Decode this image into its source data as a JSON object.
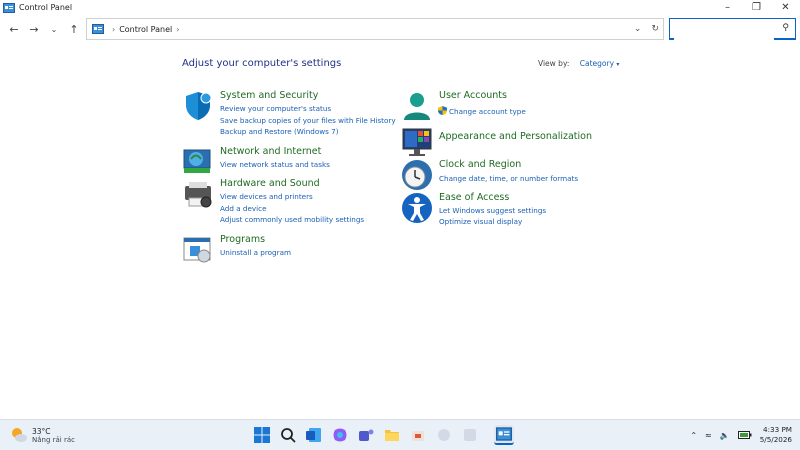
{
  "window": {
    "title": "Control Panel",
    "minimize_icon": "minimize-icon",
    "maximize_icon": "restore-icon",
    "close_icon": "close-icon"
  },
  "address_bar": {
    "breadcrumb": "Control Panel",
    "search_placeholder": ""
  },
  "main": {
    "heading": "Adjust your computer's settings",
    "view_by_label": "View by:",
    "view_by_value": "Category",
    "categories_left": [
      {
        "title": "System and Security",
        "icon": "shield-icon",
        "links": [
          "Review your computer's status",
          "Save backup copies of your files with File History",
          "Backup and Restore (Windows 7)"
        ]
      },
      {
        "title": "Network and Internet",
        "icon": "network-icon",
        "links": [
          "View network status and tasks"
        ]
      },
      {
        "title": "Hardware and Sound",
        "icon": "printer-icon",
        "links": [
          "View devices and printers",
          "Add a device",
          "Adjust commonly used mobility settings"
        ]
      },
      {
        "title": "Programs",
        "icon": "programs-icon",
        "links": [
          "Uninstall a program"
        ]
      }
    ],
    "categories_right": [
      {
        "title": "User Accounts",
        "icon": "user-icon",
        "links": [
          "Change account type"
        ]
      },
      {
        "title": "Appearance and Personalization",
        "icon": "monitor-icon",
        "links": []
      },
      {
        "title": "Clock and Region",
        "icon": "clock-icon",
        "links": [
          "Change date, time, or number formats"
        ]
      },
      {
        "title": "Ease of Access",
        "icon": "accessibility-icon",
        "links": [
          "Let Windows suggest settings",
          "Optimize visual display"
        ]
      }
    ]
  },
  "taskbar": {
    "weather_temp": "33°C",
    "weather_desc": "Nắng rải rác",
    "time": "4:33 PM",
    "date": "5/5/2026"
  },
  "colors": {
    "heading": "#1e3287",
    "category_title": "#1e6b22",
    "link": "#1a5fb4",
    "accent": "#0a64c8"
  }
}
